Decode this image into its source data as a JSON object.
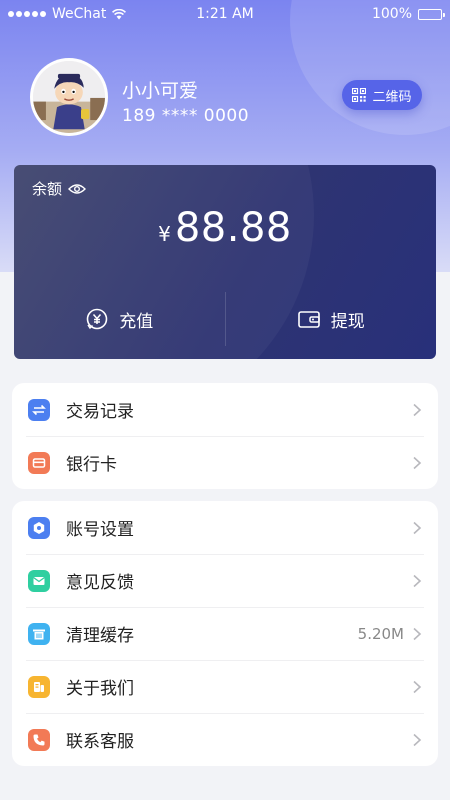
{
  "status_bar": {
    "carrier": "WeChat",
    "time": "1:21 AM",
    "battery": "100%"
  },
  "profile": {
    "name": "小小可爱",
    "phone": "189 **** 0000",
    "qr_label": "二维码"
  },
  "balance": {
    "label": "余额",
    "currency": "¥",
    "amount": "88.88",
    "recharge_label": "充值",
    "withdraw_label": "提现"
  },
  "menu_group_1": [
    {
      "label": "交易记录",
      "icon": "transfer-icon",
      "color": "#4c7ff0"
    },
    {
      "label": "银行卡",
      "icon": "card-icon",
      "color": "#f27a56"
    }
  ],
  "menu_group_2": [
    {
      "label": "账号设置",
      "icon": "settings-icon",
      "color": "#4c7ff0"
    },
    {
      "label": "意见反馈",
      "icon": "mail-icon",
      "color": "#2fcfa0"
    },
    {
      "label": "清理缓存",
      "icon": "trash-icon",
      "color": "#3fb2f0",
      "value": "5.20M"
    },
    {
      "label": "关于我们",
      "icon": "info-icon",
      "color": "#f7b531"
    },
    {
      "label": "联系客服",
      "icon": "phone-icon",
      "color": "#f27a56"
    }
  ],
  "colors": {
    "primary": "#5664e8",
    "card": "#2e3472"
  }
}
